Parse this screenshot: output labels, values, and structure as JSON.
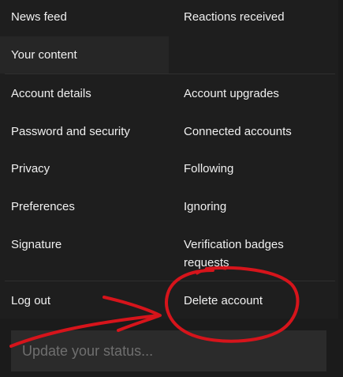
{
  "menu": {
    "news_feed": "News feed",
    "reactions_received": "Reactions received",
    "your_content": "Your content",
    "account_details": "Account details",
    "account_upgrades": "Account upgrades",
    "password_security": "Password and security",
    "connected_accounts": "Connected accounts",
    "privacy": "Privacy",
    "following": "Following",
    "preferences": "Preferences",
    "ignoring": "Ignoring",
    "signature": "Signature",
    "verification_line1": "Verification badges",
    "verification_line2": "requests",
    "log_out": "Log out",
    "delete_account": "Delete account"
  },
  "status": {
    "placeholder": "Update your status..."
  },
  "colors": {
    "background": "#1e1e1e",
    "highlight": "#262626",
    "input_background": "#2b2b2b",
    "annotation": "#d6141b"
  }
}
